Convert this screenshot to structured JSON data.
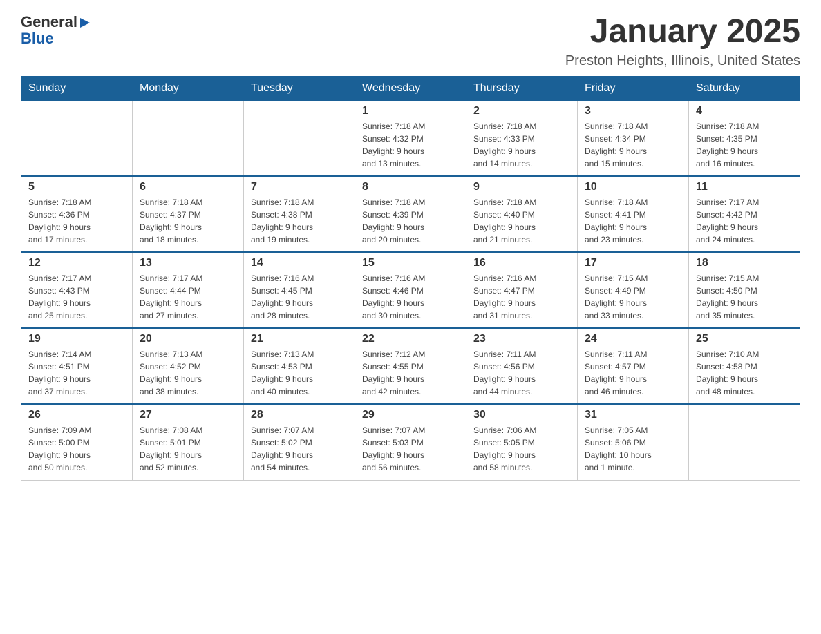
{
  "header": {
    "logo": {
      "general": "General",
      "arrow": "▶",
      "blue": "Blue"
    },
    "title": "January 2025",
    "subtitle": "Preston Heights, Illinois, United States"
  },
  "calendar": {
    "days_of_week": [
      "Sunday",
      "Monday",
      "Tuesday",
      "Wednesday",
      "Thursday",
      "Friday",
      "Saturday"
    ],
    "weeks": [
      {
        "days": [
          {
            "number": "",
            "info": ""
          },
          {
            "number": "",
            "info": ""
          },
          {
            "number": "",
            "info": ""
          },
          {
            "number": "1",
            "info": "Sunrise: 7:18 AM\nSunset: 4:32 PM\nDaylight: 9 hours\nand 13 minutes."
          },
          {
            "number": "2",
            "info": "Sunrise: 7:18 AM\nSunset: 4:33 PM\nDaylight: 9 hours\nand 14 minutes."
          },
          {
            "number": "3",
            "info": "Sunrise: 7:18 AM\nSunset: 4:34 PM\nDaylight: 9 hours\nand 15 minutes."
          },
          {
            "number": "4",
            "info": "Sunrise: 7:18 AM\nSunset: 4:35 PM\nDaylight: 9 hours\nand 16 minutes."
          }
        ]
      },
      {
        "days": [
          {
            "number": "5",
            "info": "Sunrise: 7:18 AM\nSunset: 4:36 PM\nDaylight: 9 hours\nand 17 minutes."
          },
          {
            "number": "6",
            "info": "Sunrise: 7:18 AM\nSunset: 4:37 PM\nDaylight: 9 hours\nand 18 minutes."
          },
          {
            "number": "7",
            "info": "Sunrise: 7:18 AM\nSunset: 4:38 PM\nDaylight: 9 hours\nand 19 minutes."
          },
          {
            "number": "8",
            "info": "Sunrise: 7:18 AM\nSunset: 4:39 PM\nDaylight: 9 hours\nand 20 minutes."
          },
          {
            "number": "9",
            "info": "Sunrise: 7:18 AM\nSunset: 4:40 PM\nDaylight: 9 hours\nand 21 minutes."
          },
          {
            "number": "10",
            "info": "Sunrise: 7:18 AM\nSunset: 4:41 PM\nDaylight: 9 hours\nand 23 minutes."
          },
          {
            "number": "11",
            "info": "Sunrise: 7:17 AM\nSunset: 4:42 PM\nDaylight: 9 hours\nand 24 minutes."
          }
        ]
      },
      {
        "days": [
          {
            "number": "12",
            "info": "Sunrise: 7:17 AM\nSunset: 4:43 PM\nDaylight: 9 hours\nand 25 minutes."
          },
          {
            "number": "13",
            "info": "Sunrise: 7:17 AM\nSunset: 4:44 PM\nDaylight: 9 hours\nand 27 minutes."
          },
          {
            "number": "14",
            "info": "Sunrise: 7:16 AM\nSunset: 4:45 PM\nDaylight: 9 hours\nand 28 minutes."
          },
          {
            "number": "15",
            "info": "Sunrise: 7:16 AM\nSunset: 4:46 PM\nDaylight: 9 hours\nand 30 minutes."
          },
          {
            "number": "16",
            "info": "Sunrise: 7:16 AM\nSunset: 4:47 PM\nDaylight: 9 hours\nand 31 minutes."
          },
          {
            "number": "17",
            "info": "Sunrise: 7:15 AM\nSunset: 4:49 PM\nDaylight: 9 hours\nand 33 minutes."
          },
          {
            "number": "18",
            "info": "Sunrise: 7:15 AM\nSunset: 4:50 PM\nDaylight: 9 hours\nand 35 minutes."
          }
        ]
      },
      {
        "days": [
          {
            "number": "19",
            "info": "Sunrise: 7:14 AM\nSunset: 4:51 PM\nDaylight: 9 hours\nand 37 minutes."
          },
          {
            "number": "20",
            "info": "Sunrise: 7:13 AM\nSunset: 4:52 PM\nDaylight: 9 hours\nand 38 minutes."
          },
          {
            "number": "21",
            "info": "Sunrise: 7:13 AM\nSunset: 4:53 PM\nDaylight: 9 hours\nand 40 minutes."
          },
          {
            "number": "22",
            "info": "Sunrise: 7:12 AM\nSunset: 4:55 PM\nDaylight: 9 hours\nand 42 minutes."
          },
          {
            "number": "23",
            "info": "Sunrise: 7:11 AM\nSunset: 4:56 PM\nDaylight: 9 hours\nand 44 minutes."
          },
          {
            "number": "24",
            "info": "Sunrise: 7:11 AM\nSunset: 4:57 PM\nDaylight: 9 hours\nand 46 minutes."
          },
          {
            "number": "25",
            "info": "Sunrise: 7:10 AM\nSunset: 4:58 PM\nDaylight: 9 hours\nand 48 minutes."
          }
        ]
      },
      {
        "days": [
          {
            "number": "26",
            "info": "Sunrise: 7:09 AM\nSunset: 5:00 PM\nDaylight: 9 hours\nand 50 minutes."
          },
          {
            "number": "27",
            "info": "Sunrise: 7:08 AM\nSunset: 5:01 PM\nDaylight: 9 hours\nand 52 minutes."
          },
          {
            "number": "28",
            "info": "Sunrise: 7:07 AM\nSunset: 5:02 PM\nDaylight: 9 hours\nand 54 minutes."
          },
          {
            "number": "29",
            "info": "Sunrise: 7:07 AM\nSunset: 5:03 PM\nDaylight: 9 hours\nand 56 minutes."
          },
          {
            "number": "30",
            "info": "Sunrise: 7:06 AM\nSunset: 5:05 PM\nDaylight: 9 hours\nand 58 minutes."
          },
          {
            "number": "31",
            "info": "Sunrise: 7:05 AM\nSunset: 5:06 PM\nDaylight: 10 hours\nand 1 minute."
          },
          {
            "number": "",
            "info": ""
          }
        ]
      }
    ]
  }
}
